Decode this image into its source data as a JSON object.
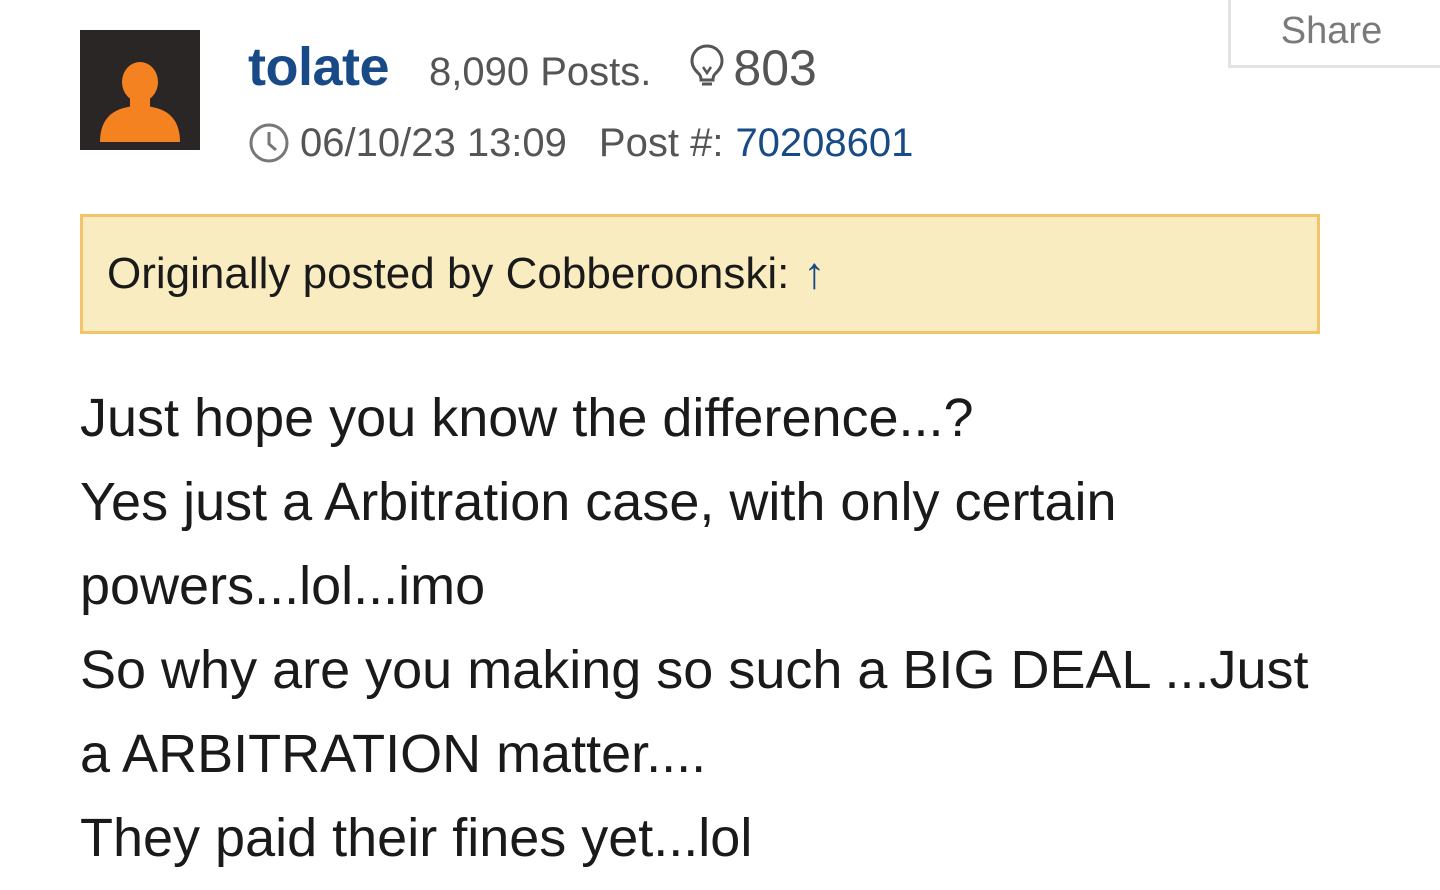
{
  "share": {
    "label": "Share"
  },
  "author": {
    "username": "tolate",
    "posts": "8,090 Posts.",
    "likes_icon": "lightbulb-icon",
    "likes": "803",
    "avatar_icon": "user-silhouette-icon"
  },
  "meta": {
    "clock_icon": "clock-icon",
    "timestamp": "06/10/23 13:09",
    "post_number_label": "Post #:",
    "post_number": "70208601"
  },
  "quote": {
    "text": "Originally posted by Cobberoonski:",
    "arrow": "↑"
  },
  "body": {
    "lines": [
      "Just hope you know the difference...?",
      "Yes just a Arbitration case, with only certain",
      "powers...lol...imo",
      "So why are you making so such a BIG DEAL ...Just",
      "a ARBITRATION matter....",
      "They paid their fines yet...lol"
    ]
  },
  "colors": {
    "username": "#174a86",
    "avatar_bg": "#2a2626",
    "avatar_figure": "#f58220",
    "quote_bg": "#f8ecc0",
    "quote_border": "#f3c46a",
    "meta_text": "#555555"
  }
}
